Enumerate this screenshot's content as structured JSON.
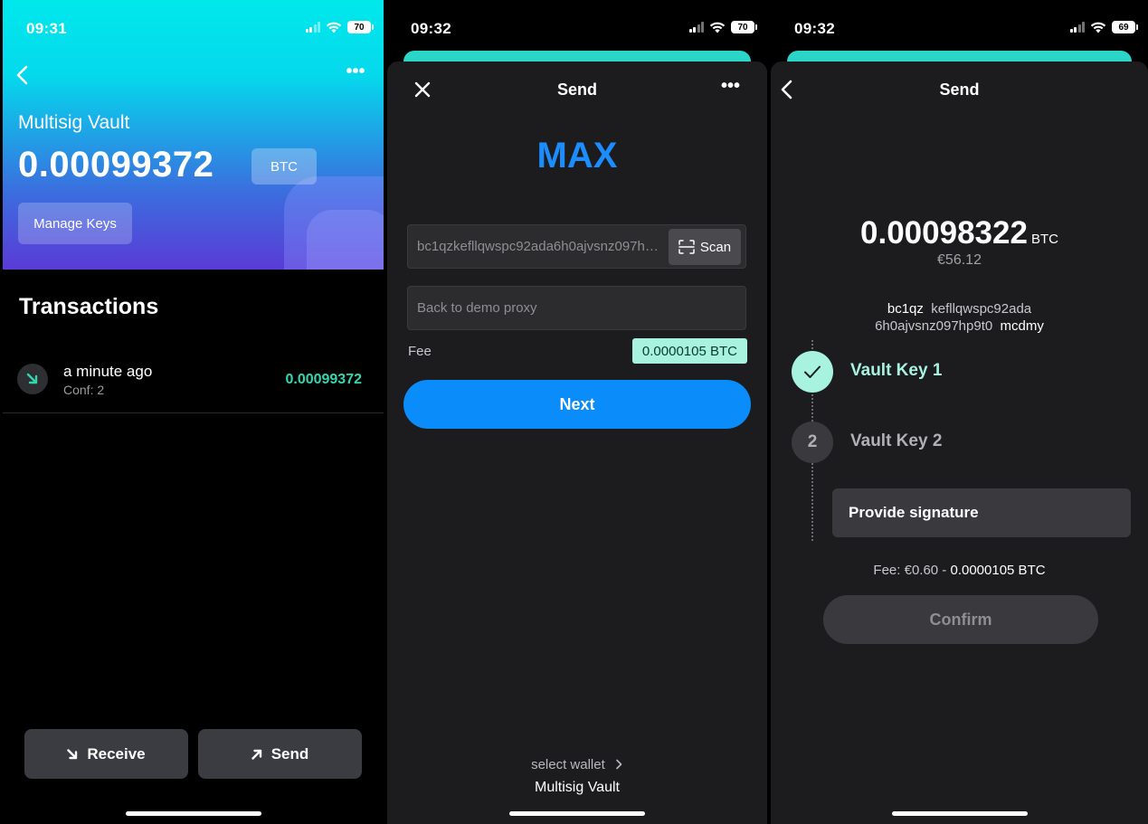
{
  "screen1": {
    "status": {
      "time": "09:31",
      "battery": "70"
    },
    "wallet_label": "Multisig Vault",
    "balance": "0.00099372",
    "unit": "BTC",
    "manage_keys": "Manage Keys",
    "transactions_title": "Transactions",
    "transactions": [
      {
        "when": "a minute ago",
        "conf": "Conf: 2",
        "amount": "0.00099372",
        "direction": "incoming"
      }
    ],
    "receive_label": "Receive",
    "send_label": "Send"
  },
  "screen2": {
    "status": {
      "time": "09:32",
      "battery": "70"
    },
    "title": "Send",
    "amount_display": "MAX",
    "address_value": "bc1qzkefllqwspc92ada6h0ajvsnz097hp9t0mcdmy",
    "scan_label": "Scan",
    "memo_placeholder": "Back to demo proxy",
    "fee_label": "Fee",
    "fee_value": "0.0000105 BTC",
    "next_label": "Next",
    "select_wallet": "select wallet",
    "wallet_name": "Multisig Vault"
  },
  "screen3": {
    "status": {
      "time": "09:32",
      "battery": "69"
    },
    "title": "Send",
    "amount": "0.00098322",
    "unit": "BTC",
    "fiat": "€56.12",
    "address_line1": {
      "a": "bc1qz",
      "b": "kefllqwspc92ada"
    },
    "address_line2": {
      "a": "6h0ajvsnz097hp9t0",
      "b": "mcdmy"
    },
    "steps": [
      {
        "number": "1",
        "label": "Vault Key 1",
        "done": true
      },
      {
        "number": "2",
        "label": "Vault Key 2",
        "done": false
      }
    ],
    "provide_signature": "Provide signature",
    "fee_prefix": "Fee: €0.60 - ",
    "fee_btc": "0.0000105 BTC",
    "confirm_label": "Confirm"
  },
  "colors": {
    "accent_teal": "#34d6b0",
    "accent_blue": "#0a8cfb",
    "mint": "#a7f3df"
  }
}
